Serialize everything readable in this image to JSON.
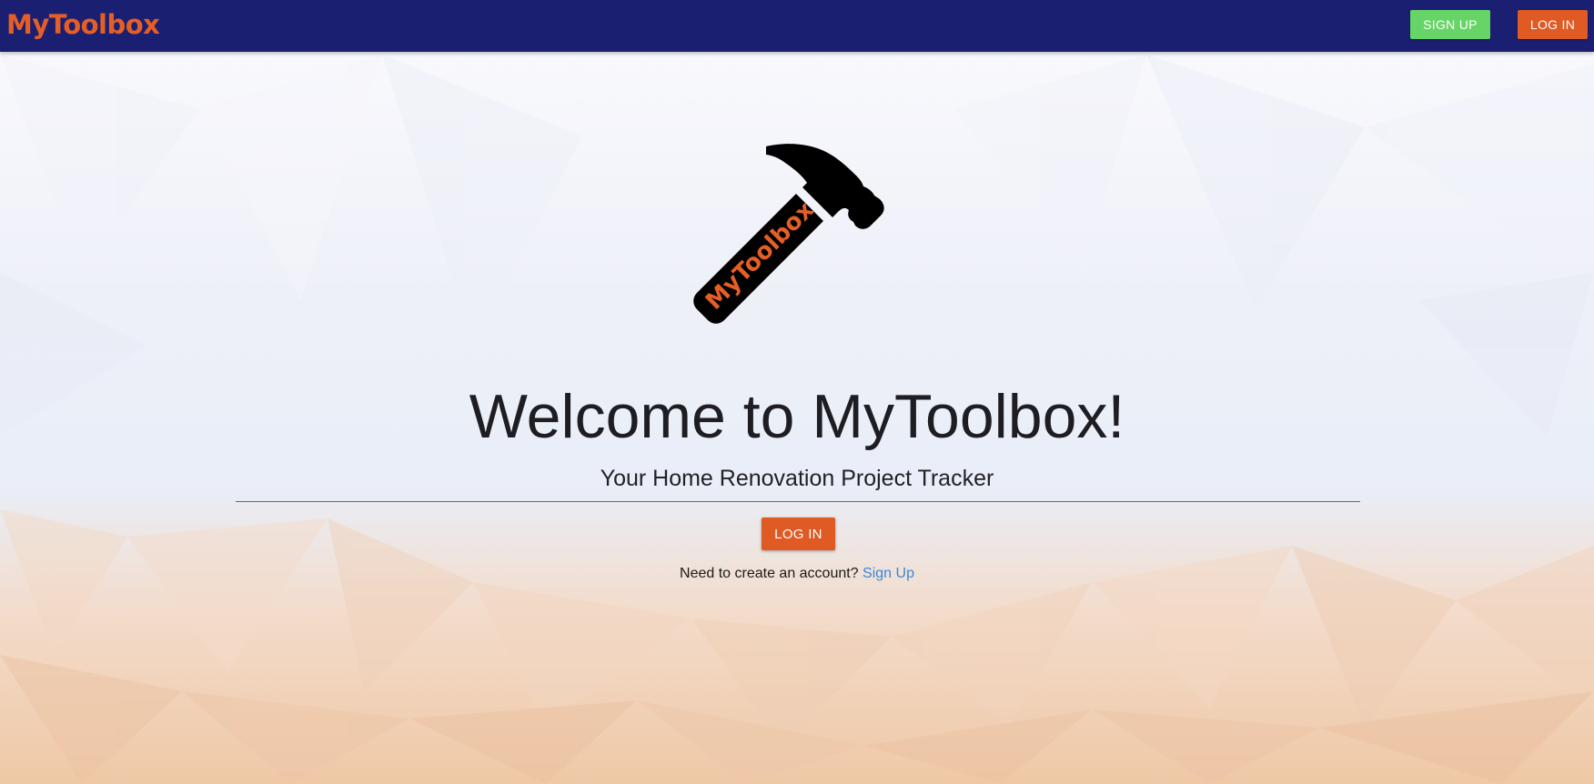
{
  "navbar": {
    "brand": "MyToolbox",
    "signup_label": "SIGN UP",
    "login_label": "LOG IN"
  },
  "hero": {
    "logo_icon": "hammer-icon",
    "logo_text": "MyToolbox",
    "title": "Welcome to MyToolbox!",
    "subtitle": "Your Home Renovation Project Tracker",
    "login_label": "LOG IN",
    "signup_prompt": "Need to create an account?",
    "signup_link": "Sign Up"
  },
  "colors": {
    "navbar_bg": "#1b1f72",
    "brand": "#e55f25",
    "signup_button": "#66d466",
    "login_button": "#e05a23",
    "link": "#3d86d8"
  }
}
